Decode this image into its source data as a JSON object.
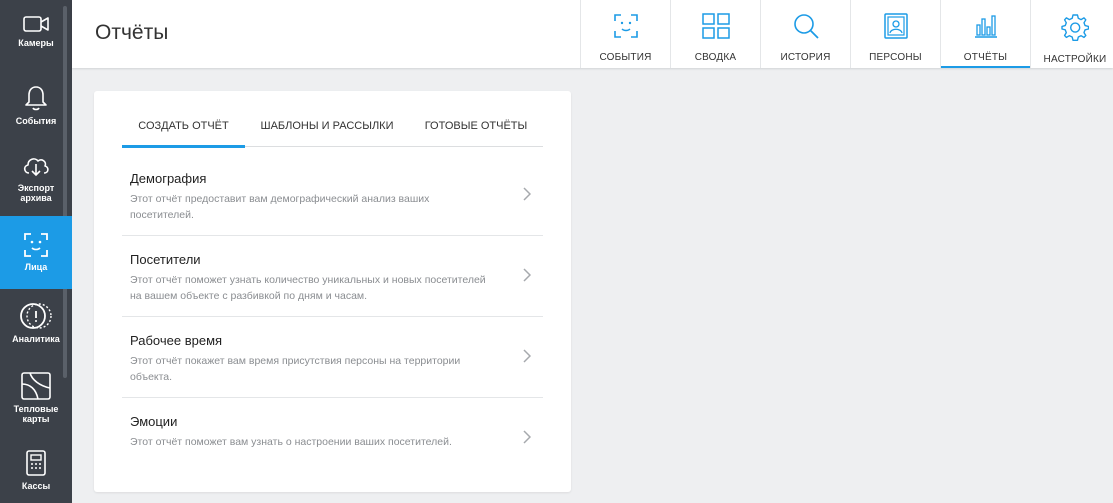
{
  "sidebar": {
    "items": [
      {
        "label": "Камеры",
        "icon": "camera-icon"
      },
      {
        "label": "События",
        "icon": "bell-icon"
      },
      {
        "label": "Экспорт архива",
        "icon": "cloud-download-icon"
      },
      {
        "label": "Лица",
        "icon": "face-scan-icon",
        "active": true
      },
      {
        "label": "Аналитика",
        "icon": "analytics-icon"
      },
      {
        "label": "Тепловые карты",
        "icon": "heatmap-icon"
      },
      {
        "label": "Кассы",
        "icon": "cash-register-icon"
      }
    ]
  },
  "header": {
    "title": "Отчёты",
    "nav": [
      {
        "label": "СОБЫТИЯ",
        "icon": "face-scan-icon"
      },
      {
        "label": "СВОДКА",
        "icon": "dashboard-icon"
      },
      {
        "label": "ИСТОРИЯ",
        "icon": "search-icon"
      },
      {
        "label": "ПЕРСОНЫ",
        "icon": "person-card-icon"
      },
      {
        "label": "ОТЧЁТЫ",
        "icon": "bar-chart-icon",
        "active": true
      },
      {
        "label": "НАСТРОЙКИ",
        "icon": "gear-icon"
      }
    ]
  },
  "tabs": [
    {
      "label": "СОЗДАТЬ ОТЧЁТ",
      "active": true
    },
    {
      "label": "ШАБЛОНЫ И РАССЫЛКИ"
    },
    {
      "label": "ГОТОВЫЕ ОТЧЁТЫ"
    }
  ],
  "reports": [
    {
      "title": "Демография",
      "description": "Этот отчёт предоставит вам демографический анализ ваших посетителей."
    },
    {
      "title": "Посетители",
      "description": "Этот отчёт поможет узнать количество уникальных и новых посетителей на вашем объекте с разбивкой по дням и часам."
    },
    {
      "title": "Рабочее время",
      "description": "Этот отчёт покажет вам время присутствия персоны на территории объекта."
    },
    {
      "title": "Эмоции",
      "description": "Этот отчёт поможет вам узнать о настроении ваших посетителей."
    }
  ],
  "colors": {
    "accent": "#1c9be6",
    "sidebar": "#3c4149",
    "background": "#eeeff1"
  }
}
